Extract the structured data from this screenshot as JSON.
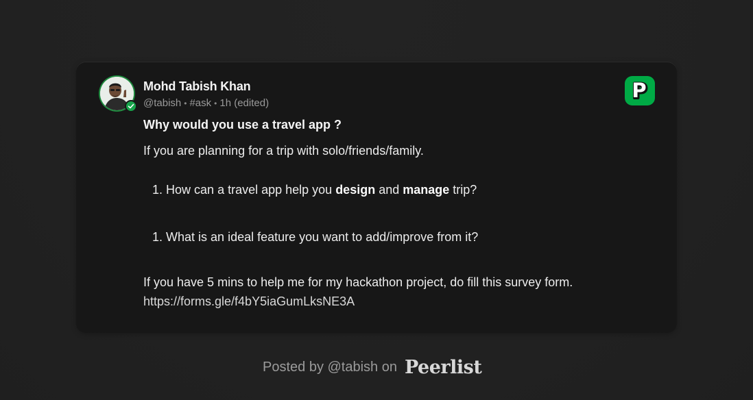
{
  "post": {
    "author_name": "Mohd Tabish Khan",
    "handle": "@tabish",
    "tag": "#ask",
    "time": "1h (edited)",
    "separator": "•",
    "title": "Why would you use a travel app ?",
    "intro": "If you are planning for a trip with solo/friends/family.",
    "list_1": {
      "number": "1.",
      "text_before": "How can a travel app help you ",
      "bold_1": "design",
      "text_mid": " and ",
      "bold_2": "manage",
      "text_after": " trip?"
    },
    "list_2": {
      "number": "1.",
      "text": "What is an ideal feature you want to add/improve from it?"
    },
    "closing": "If you have 5 mins to help me for my hackathon project, do fill this survey form.",
    "link": "https://forms.gle/f4bY5iaGumLksNE3A"
  },
  "brand": {
    "logo_letter": "P",
    "accent_color": "#00AA45",
    "verified_color": "#16A34A"
  },
  "footer": {
    "text": "Posted by @tabish on",
    "brand_name": "Peerlist"
  },
  "icons": {
    "avatar": "avatar-photo",
    "verified": "verified-check-icon",
    "logo": "peerlist-logo-icon"
  }
}
